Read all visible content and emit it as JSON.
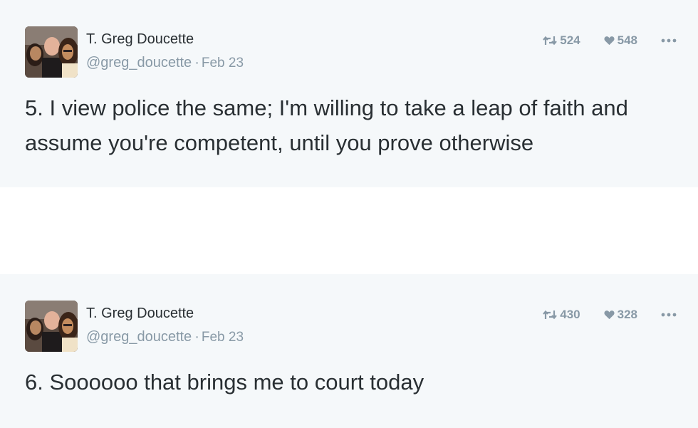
{
  "tweets": [
    {
      "author_name": "T. Greg Doucette",
      "handle": "@greg_doucette",
      "separator": "·",
      "date": "Feb 23",
      "retweets": "524",
      "likes": "548",
      "text": "5. I view police the same; I'm willing to take a leap of faith and assume you're competent, until you prove otherwise"
    },
    {
      "author_name": "T. Greg Doucette",
      "handle": "@greg_doucette",
      "separator": "·",
      "date": "Feb 23",
      "retweets": "430",
      "likes": "328",
      "text": "6. Soooooo that brings me to court today"
    }
  ],
  "icons": {
    "retweet": "retweet-icon",
    "like": "heart-icon",
    "more": "more-options-icon",
    "avatar": "avatar-photo"
  },
  "colors": {
    "card_background": "#f5f8fa",
    "page_background": "#ffffff",
    "primary_text": "#292f33",
    "secondary_text": "#8899a6"
  }
}
